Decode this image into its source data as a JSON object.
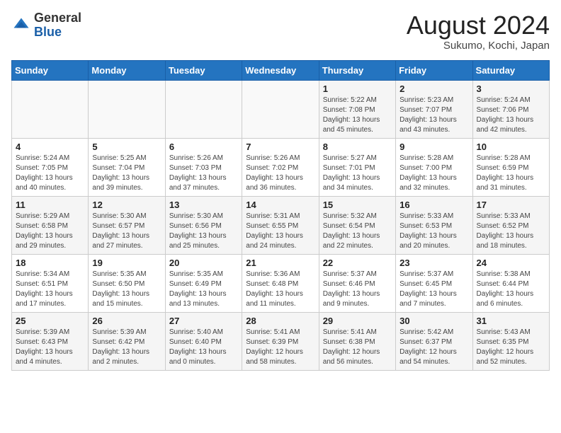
{
  "header": {
    "logo_general": "General",
    "logo_blue": "Blue",
    "month_title": "August 2024",
    "location": "Sukumo, Kochi, Japan"
  },
  "weekdays": [
    "Sunday",
    "Monday",
    "Tuesday",
    "Wednesday",
    "Thursday",
    "Friday",
    "Saturday"
  ],
  "weeks": [
    [
      {
        "day": "",
        "info": ""
      },
      {
        "day": "",
        "info": ""
      },
      {
        "day": "",
        "info": ""
      },
      {
        "day": "",
        "info": ""
      },
      {
        "day": "1",
        "info": "Sunrise: 5:22 AM\nSunset: 7:08 PM\nDaylight: 13 hours\nand 45 minutes."
      },
      {
        "day": "2",
        "info": "Sunrise: 5:23 AM\nSunset: 7:07 PM\nDaylight: 13 hours\nand 43 minutes."
      },
      {
        "day": "3",
        "info": "Sunrise: 5:24 AM\nSunset: 7:06 PM\nDaylight: 13 hours\nand 42 minutes."
      }
    ],
    [
      {
        "day": "4",
        "info": "Sunrise: 5:24 AM\nSunset: 7:05 PM\nDaylight: 13 hours\nand 40 minutes."
      },
      {
        "day": "5",
        "info": "Sunrise: 5:25 AM\nSunset: 7:04 PM\nDaylight: 13 hours\nand 39 minutes."
      },
      {
        "day": "6",
        "info": "Sunrise: 5:26 AM\nSunset: 7:03 PM\nDaylight: 13 hours\nand 37 minutes."
      },
      {
        "day": "7",
        "info": "Sunrise: 5:26 AM\nSunset: 7:02 PM\nDaylight: 13 hours\nand 36 minutes."
      },
      {
        "day": "8",
        "info": "Sunrise: 5:27 AM\nSunset: 7:01 PM\nDaylight: 13 hours\nand 34 minutes."
      },
      {
        "day": "9",
        "info": "Sunrise: 5:28 AM\nSunset: 7:00 PM\nDaylight: 13 hours\nand 32 minutes."
      },
      {
        "day": "10",
        "info": "Sunrise: 5:28 AM\nSunset: 6:59 PM\nDaylight: 13 hours\nand 31 minutes."
      }
    ],
    [
      {
        "day": "11",
        "info": "Sunrise: 5:29 AM\nSunset: 6:58 PM\nDaylight: 13 hours\nand 29 minutes."
      },
      {
        "day": "12",
        "info": "Sunrise: 5:30 AM\nSunset: 6:57 PM\nDaylight: 13 hours\nand 27 minutes."
      },
      {
        "day": "13",
        "info": "Sunrise: 5:30 AM\nSunset: 6:56 PM\nDaylight: 13 hours\nand 25 minutes."
      },
      {
        "day": "14",
        "info": "Sunrise: 5:31 AM\nSunset: 6:55 PM\nDaylight: 13 hours\nand 24 minutes."
      },
      {
        "day": "15",
        "info": "Sunrise: 5:32 AM\nSunset: 6:54 PM\nDaylight: 13 hours\nand 22 minutes."
      },
      {
        "day": "16",
        "info": "Sunrise: 5:33 AM\nSunset: 6:53 PM\nDaylight: 13 hours\nand 20 minutes."
      },
      {
        "day": "17",
        "info": "Sunrise: 5:33 AM\nSunset: 6:52 PM\nDaylight: 13 hours\nand 18 minutes."
      }
    ],
    [
      {
        "day": "18",
        "info": "Sunrise: 5:34 AM\nSunset: 6:51 PM\nDaylight: 13 hours\nand 17 minutes."
      },
      {
        "day": "19",
        "info": "Sunrise: 5:35 AM\nSunset: 6:50 PM\nDaylight: 13 hours\nand 15 minutes."
      },
      {
        "day": "20",
        "info": "Sunrise: 5:35 AM\nSunset: 6:49 PM\nDaylight: 13 hours\nand 13 minutes."
      },
      {
        "day": "21",
        "info": "Sunrise: 5:36 AM\nSunset: 6:48 PM\nDaylight: 13 hours\nand 11 minutes."
      },
      {
        "day": "22",
        "info": "Sunrise: 5:37 AM\nSunset: 6:46 PM\nDaylight: 13 hours\nand 9 minutes."
      },
      {
        "day": "23",
        "info": "Sunrise: 5:37 AM\nSunset: 6:45 PM\nDaylight: 13 hours\nand 7 minutes."
      },
      {
        "day": "24",
        "info": "Sunrise: 5:38 AM\nSunset: 6:44 PM\nDaylight: 13 hours\nand 6 minutes."
      }
    ],
    [
      {
        "day": "25",
        "info": "Sunrise: 5:39 AM\nSunset: 6:43 PM\nDaylight: 13 hours\nand 4 minutes."
      },
      {
        "day": "26",
        "info": "Sunrise: 5:39 AM\nSunset: 6:42 PM\nDaylight: 13 hours\nand 2 minutes."
      },
      {
        "day": "27",
        "info": "Sunrise: 5:40 AM\nSunset: 6:40 PM\nDaylight: 13 hours\nand 0 minutes."
      },
      {
        "day": "28",
        "info": "Sunrise: 5:41 AM\nSunset: 6:39 PM\nDaylight: 12 hours\nand 58 minutes."
      },
      {
        "day": "29",
        "info": "Sunrise: 5:41 AM\nSunset: 6:38 PM\nDaylight: 12 hours\nand 56 minutes."
      },
      {
        "day": "30",
        "info": "Sunrise: 5:42 AM\nSunset: 6:37 PM\nDaylight: 12 hours\nand 54 minutes."
      },
      {
        "day": "31",
        "info": "Sunrise: 5:43 AM\nSunset: 6:35 PM\nDaylight: 12 hours\nand 52 minutes."
      }
    ]
  ]
}
